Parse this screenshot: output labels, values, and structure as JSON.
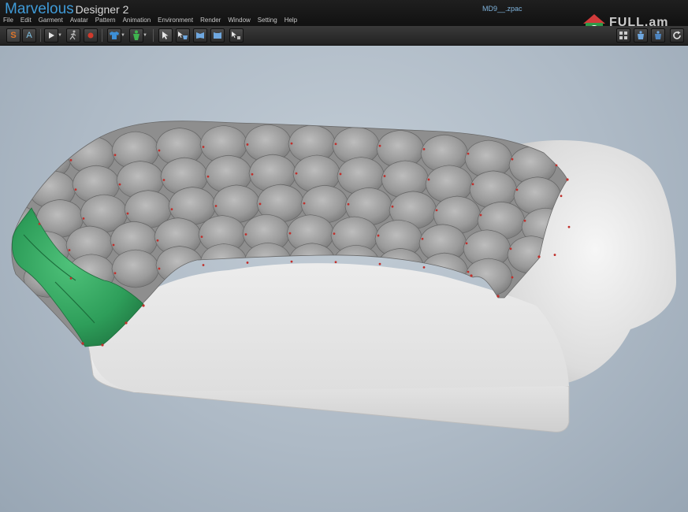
{
  "app": {
    "title_main": "Marvelous",
    "title_sub": "Designer 2",
    "file_name": "MD9__.zpac"
  },
  "menu": [
    "File",
    "Edit",
    "Garment",
    "Avatar",
    "Pattern",
    "Animation",
    "Environment",
    "Render",
    "Window",
    "Setting",
    "Help"
  ],
  "toolbar": {
    "mode_s_label": "S",
    "mode_a_label": "A"
  },
  "watermark": {
    "text": "FULL.am"
  },
  "colors": {
    "accent": "#3f9bd8",
    "quilt_gray": "#8a8a8a",
    "selected_green": "#2e9e5a",
    "sofa_white": "#e9e9e9",
    "pin_red": "#c0302c"
  }
}
